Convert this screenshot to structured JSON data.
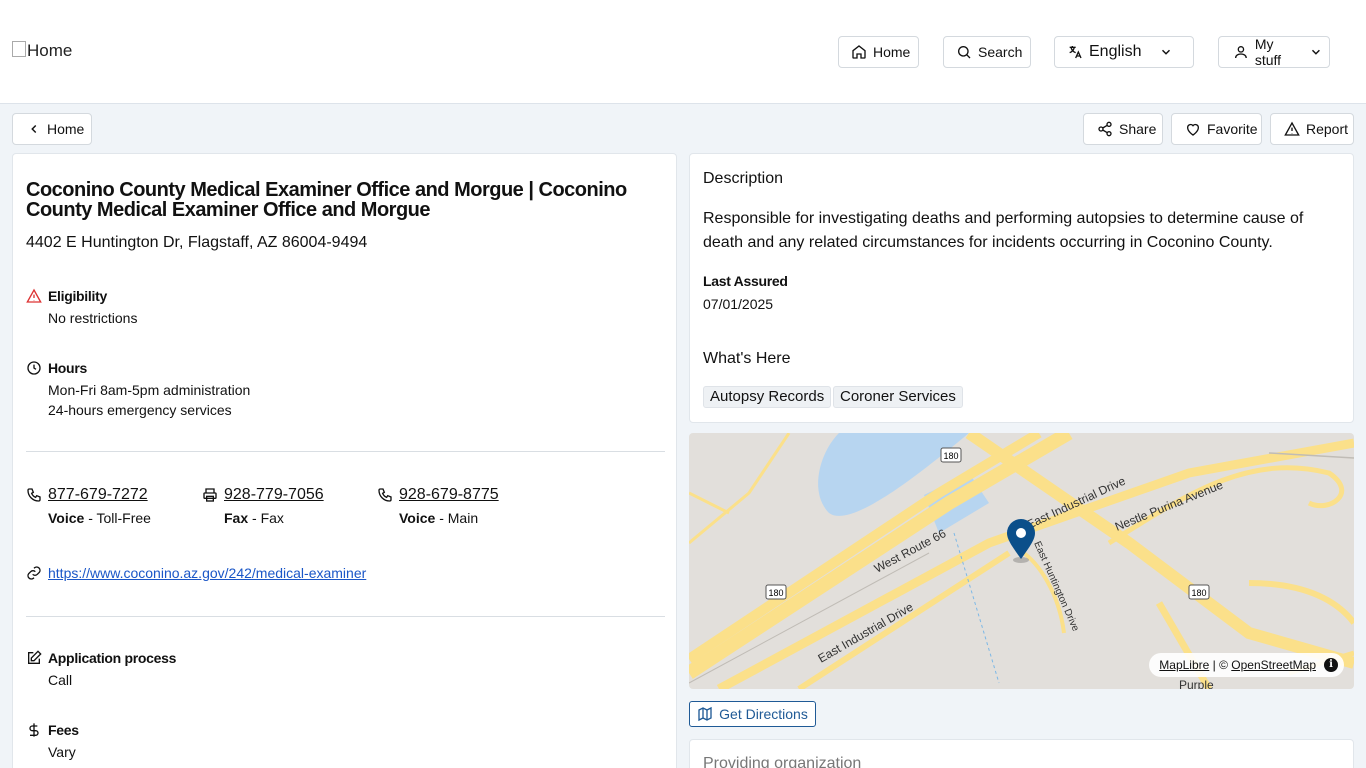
{
  "header": {
    "logo_alt": "Home",
    "nav": {
      "home": "Home",
      "search": "Search",
      "language": "English",
      "my_stuff": "My stuff"
    }
  },
  "subbar": {
    "back": "Home",
    "share": "Share",
    "favorite": "Favorite",
    "report": "Report"
  },
  "service": {
    "title": "Coconino County Medical Examiner Office and Morgue | Coconino County Medical Examiner Office and Morgue",
    "address": "4402 E Huntington Dr, Flagstaff, AZ 86004-9494",
    "eligibility": {
      "label": "Eligibility",
      "value": "No restrictions"
    },
    "hours": {
      "label": "Hours",
      "lines": [
        "Mon-Fri 8am-5pm administration",
        "24-hours emergency services"
      ]
    },
    "phones": [
      {
        "number": "877-679-7272",
        "type": "Voice",
        "desc": " - Toll-Free",
        "icon": "phone-icon"
      },
      {
        "number": "928-779-7056",
        "type": "Fax",
        "desc": " - Fax",
        "icon": "printer-icon"
      },
      {
        "number": "928-679-8775",
        "type": "Voice",
        "desc": " - Main",
        "icon": "phone-icon"
      }
    ],
    "website": "https://www.coconino.az.gov/242/medical-examiner",
    "application": {
      "label": "Application process",
      "value": "Call"
    },
    "fees": {
      "label": "Fees",
      "value": "Vary"
    }
  },
  "description": {
    "heading": "Description",
    "text": "Responsible for investigating deaths and performing autopsies to determine cause of death and any related circumstances for incidents occurring in Coconino County.",
    "last_assured_label": "Last Assured",
    "last_assured_value": "07/01/2025",
    "whats_here_heading": "What's Here",
    "tags": [
      "Autopsy Records",
      "Coroner Services"
    ]
  },
  "map": {
    "labels": {
      "route180_a": "180",
      "route180_b": "180",
      "route180_c": "180",
      "west_route_66": "West Route 66",
      "east_industrial_top": "East Industrial Drive",
      "east_industrial_bottom": "East Industrial Drive",
      "nestle": "Nestle Purina Avenue",
      "huntington": "East Huntington Drive",
      "purple": "Purple"
    },
    "attribution": {
      "maplibre": "MapLibre",
      "sep": " | © ",
      "osm": "OpenStreetMap",
      "info": "i"
    }
  },
  "directions": {
    "label": "Get Directions"
  },
  "org": {
    "heading": "Providing organization"
  },
  "colors": {
    "link": "#1a56c7",
    "accent": "#1f5a96",
    "road": "#fbe08a",
    "water": "#b7d5f0",
    "pin": "#0b4f8a",
    "warning": "#d33"
  }
}
